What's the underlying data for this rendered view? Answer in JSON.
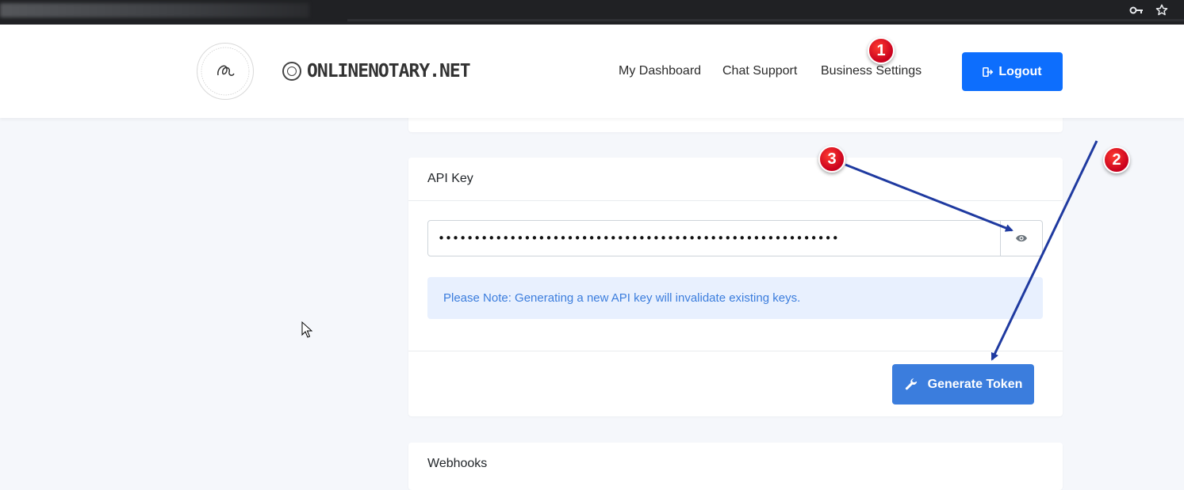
{
  "browser": {
    "icons": [
      "key-icon",
      "star-icon"
    ]
  },
  "header": {
    "brand_name": "ONLINENOTARY.NET",
    "nav": {
      "dashboard": "My Dashboard",
      "chat": "Chat Support",
      "business": "Business Settings"
    },
    "logout_label": "Logout"
  },
  "api_key_card": {
    "title": "API Key",
    "masked_value": "••••••••••••••••••••••••••••••••••••••••••••••••••••••••",
    "note": "Please Note: Generating a new API key will invalidate existing keys.",
    "generate_label": "Generate Token"
  },
  "webhooks_card": {
    "title": "Webhooks"
  },
  "annotations": {
    "badges": [
      "1",
      "2",
      "3"
    ]
  },
  "colors": {
    "primary": "#0d6efd",
    "generate_button": "#3b7ddd",
    "note_bg": "#e8f0fe",
    "note_text": "#3b7ddd",
    "annotation_red": "#e0001b",
    "arrow_blue": "#1f3aa0"
  }
}
